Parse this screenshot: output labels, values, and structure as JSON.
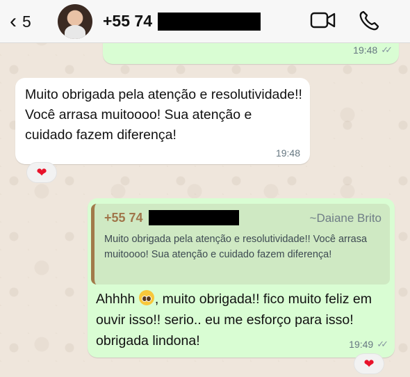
{
  "header": {
    "back_count": "5",
    "contact_prefix": "+55 74",
    "icons": [
      "chevron-left-icon",
      "video-call-icon",
      "phone-icon"
    ]
  },
  "messages": [
    {
      "direction": "outgoing",
      "time": "19:48",
      "status": "read-double-check"
    },
    {
      "direction": "incoming",
      "text": "Muito obrigada pela atenção e resolutividade!! Você arrasa muitoooo! Sua atenção e cuidado fazem diferença!",
      "time": "19:48",
      "reaction": "❤"
    },
    {
      "direction": "outgoing",
      "quote": {
        "sender_prefix": "+55 74",
        "sender_name": "~Daiane Brito",
        "text": "Muito obrigada pela atenção e resolutividade!! Você arrasa muitoooo! Sua atenção e cuidado fazem diferença!"
      },
      "text_before_emoji": "Ahhhh",
      "text_after_emoji": ", muito obrigada!! fico muito feliz em ouvir isso!! serio.. eu me esforço para isso! obrigada lindona!",
      "time": "19:49",
      "status": "read-double-check",
      "reaction": "❤"
    }
  ],
  "colors": {
    "outgoing_bubble": "#d9fdd3",
    "incoming_bubble": "#ffffff",
    "quote_bar": "#a27a4a",
    "reaction_heart": "#e8132b"
  }
}
